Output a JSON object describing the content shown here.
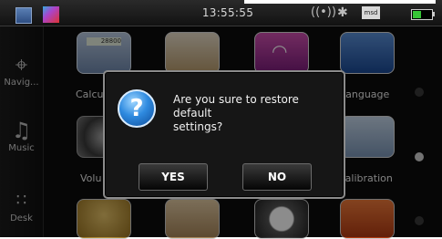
{
  "status_bar": {
    "time": "13:55:55",
    "sd_card_label": "msd",
    "battery_fraction": 0.45
  },
  "sidebar": {
    "items": [
      {
        "label": "Navig...",
        "icon": "navigation-icon"
      },
      {
        "label": "Music",
        "icon": "music-note-icon"
      },
      {
        "label": "Desk",
        "icon": "desk-grid-icon"
      }
    ]
  },
  "apps": {
    "calculator_label": "Calcul",
    "calculator_display": "28800",
    "language_label": "Language",
    "volume_label": "Volu",
    "calibration_label": "Calibration"
  },
  "page_indicator": {
    "pages": 3,
    "active_index": 1
  },
  "dialog": {
    "message_line1": "Are you sure to restore default",
    "message_line2": "settings?",
    "yes_label": "YES",
    "no_label": "NO"
  }
}
